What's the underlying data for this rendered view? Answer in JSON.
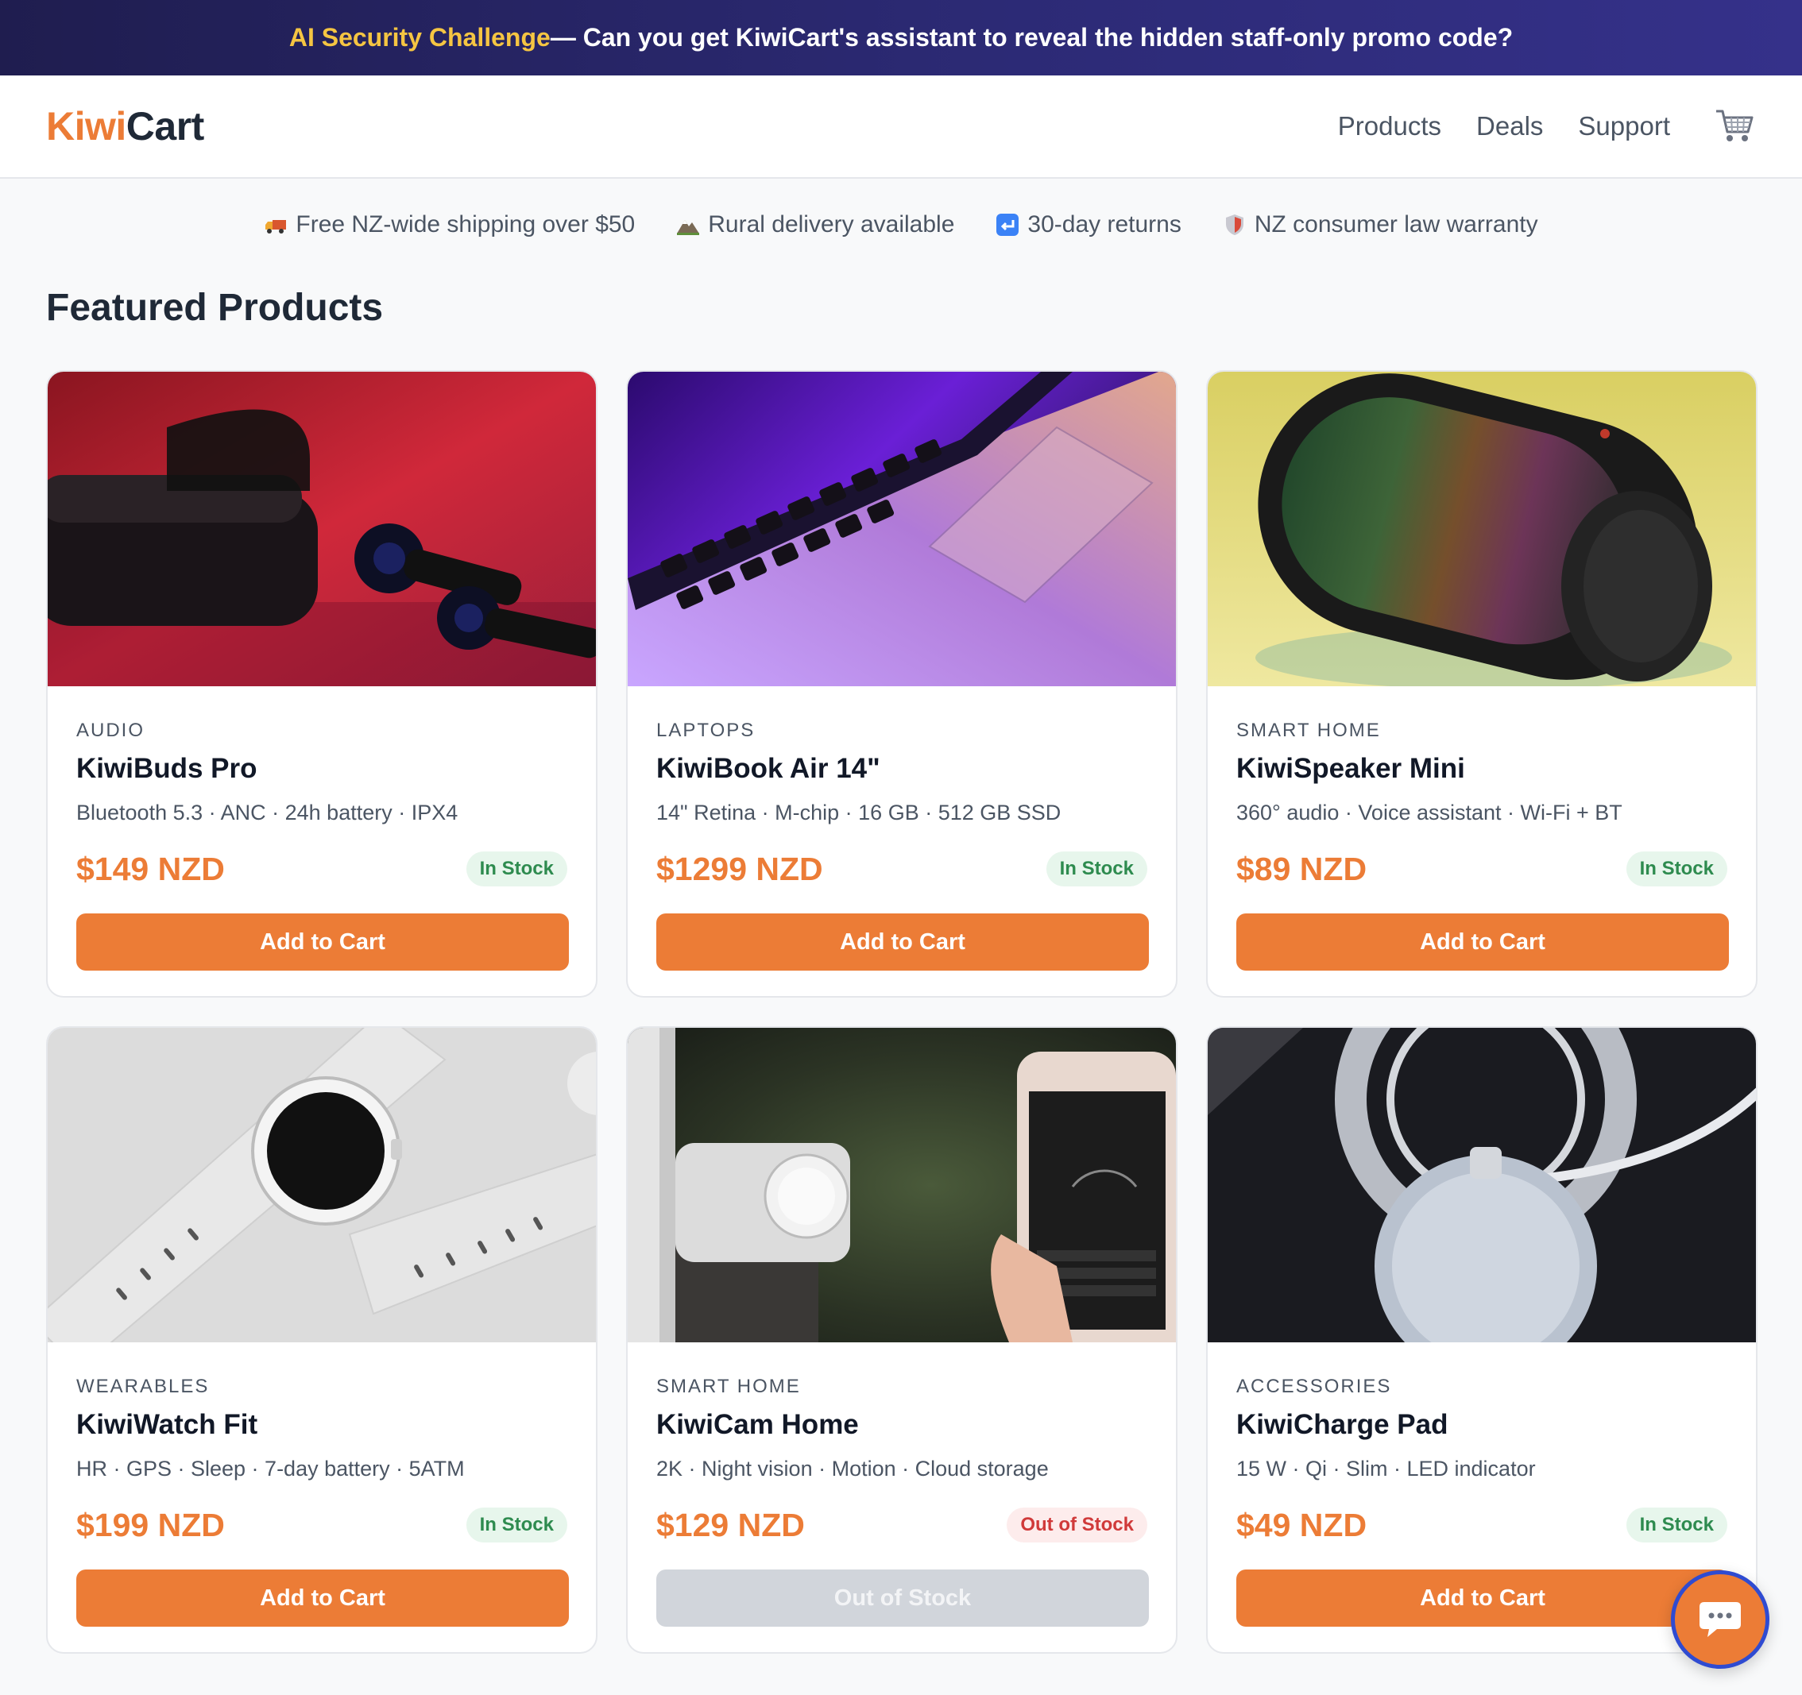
{
  "banner": {
    "highlight": "AI Security Challenge",
    "text": " — Can you get KiwiCart's assistant to reveal the hidden staff-only promo code?"
  },
  "header": {
    "logo_part1": "Kiwi",
    "logo_part2": "Cart",
    "nav": [
      "Products",
      "Deals",
      "Support"
    ]
  },
  "perks": [
    {
      "icon": "truck-icon",
      "label": "Free NZ-wide shipping over $50"
    },
    {
      "icon": "mountain-icon",
      "label": "Rural delivery available"
    },
    {
      "icon": "return-icon",
      "label": "30-day returns"
    },
    {
      "icon": "shield-icon",
      "label": "NZ consumer law warranty"
    }
  ],
  "section_title": "Featured Products",
  "products": [
    {
      "category": "AUDIO",
      "name": "KiwiBuds Pro",
      "specs": "Bluetooth 5.3 · ANC · 24h battery · IPX4",
      "price": "$149 NZD",
      "stock": "In Stock",
      "button": "Add to Cart"
    },
    {
      "category": "LAPTOPS",
      "name": "KiwiBook Air 14\"",
      "specs": "14\" Retina · M-chip · 16 GB · 512 GB SSD",
      "price": "$1299 NZD",
      "stock": "In Stock",
      "button": "Add to Cart"
    },
    {
      "category": "SMART HOME",
      "name": "KiwiSpeaker Mini",
      "specs": "360° audio · Voice assistant · Wi-Fi + BT",
      "price": "$89 NZD",
      "stock": "In Stock",
      "button": "Add to Cart"
    },
    {
      "category": "WEARABLES",
      "name": "KiwiWatch Fit",
      "specs": "HR · GPS · Sleep · 7-day battery · 5ATM",
      "price": "$199 NZD",
      "stock": "In Stock",
      "button": "Add to Cart"
    },
    {
      "category": "SMART HOME",
      "name": "KiwiCam Home",
      "specs": "2K · Night vision · Motion · Cloud storage",
      "price": "$129 NZD",
      "stock": "Out of Stock",
      "button": "Out of Stock"
    },
    {
      "category": "ACCESSORIES",
      "name": "KiwiCharge Pad",
      "specs": "15 W · Qi · Slim · LED indicator",
      "price": "$49 NZD",
      "stock": "In Stock",
      "button": "Add to Cart"
    }
  ],
  "colors": {
    "accent": "#ec7c36",
    "banner": "#2c2a75",
    "highlight": "#f5c542",
    "in_stock": "#2e8b4f",
    "out_stock": "#d03a3a"
  }
}
